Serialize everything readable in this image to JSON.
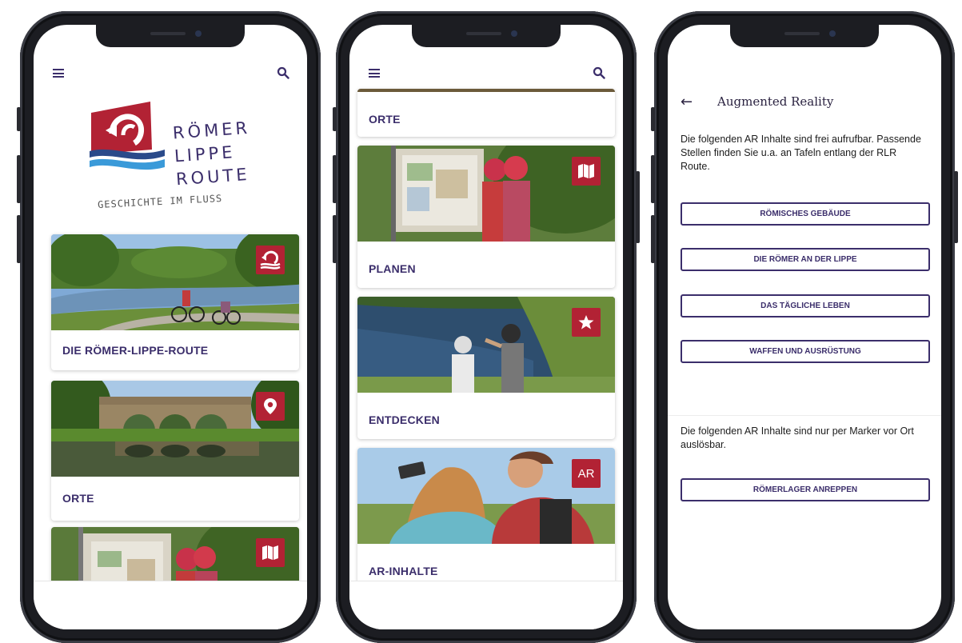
{
  "phone1": {
    "logo": {
      "line1": "RÖMER",
      "line2": "LIPPE",
      "line3": "ROUTE",
      "tagline": "GESCHICHTE IM FLUSS"
    },
    "cards": [
      {
        "label": "DIE RÖMER-LIPPE-ROUTE",
        "badge_icon": "route-logo-icon"
      },
      {
        "label": "ORTE",
        "badge_icon": "location-pin-icon"
      },
      {
        "label": "",
        "badge_icon": "map-icon"
      }
    ]
  },
  "phone2": {
    "cards": [
      {
        "label": "ORTE"
      },
      {
        "label": "PLANEN",
        "badge_icon": "map-icon"
      },
      {
        "label": "ENTDECKEN",
        "badge_icon": "star-icon"
      },
      {
        "label": "AR-INHALTE",
        "badge_text": "AR"
      }
    ]
  },
  "phone3": {
    "title": "Augmented Reality",
    "intro_free": "Die folgenden AR Inhalte sind frei aufrufbar. Passende Stellen finden Sie u.a. an Tafeln entlang der RLR Route.",
    "free_buttons": [
      "RÖMISCHES GEBÄUDE",
      "DIE RÖMER AN DER LIPPE",
      "DAS TÄGLICHE LEBEN",
      "WAFFEN UND AUSRÜSTUNG"
    ],
    "intro_marker": "Die folgenden AR Inhalte sind nur per Marker vor Ort auslösbar.",
    "marker_buttons": [
      "RÖMERLAGER ANREPPEN"
    ]
  },
  "colors": {
    "brand_purple": "#3b2e6b",
    "brand_red": "#b22234",
    "brand_blue": "#2a4a8a",
    "phone_frame": "#1c1d22"
  }
}
